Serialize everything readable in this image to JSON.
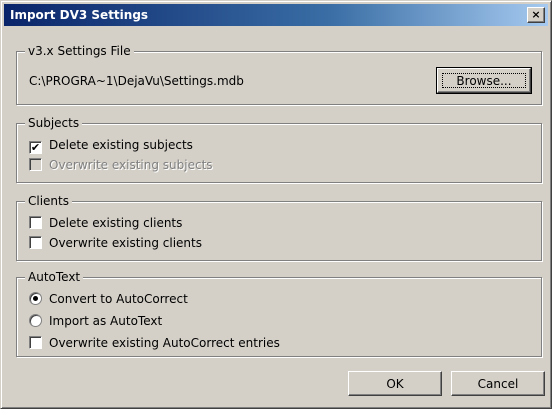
{
  "window": {
    "title": "Import DV3 Settings",
    "close_label": "×"
  },
  "settings_file": {
    "group_label": "v3.x Settings File",
    "path": "C:\\PROGRA~1\\DejaVu\\Settings.mdb",
    "browse_label": "Browse..."
  },
  "subjects": {
    "group_label": "Subjects",
    "options": [
      {
        "label": "Delete existing subjects",
        "checked": true,
        "enabled": true
      },
      {
        "label": "Overwrite existing subjects",
        "checked": false,
        "enabled": false
      }
    ]
  },
  "clients": {
    "group_label": "Clients",
    "options": [
      {
        "label": "Delete existing clients",
        "checked": false,
        "enabled": true
      },
      {
        "label": "Overwrite existing clients",
        "checked": false,
        "enabled": true
      }
    ]
  },
  "autotext": {
    "group_label": "AutoText",
    "radios": [
      {
        "label": "Convert to AutoCorrect",
        "selected": true
      },
      {
        "label": "Import as AutoText",
        "selected": false
      }
    ],
    "overwrite": {
      "label": "Overwrite existing AutoCorrect entries",
      "checked": false
    }
  },
  "buttons": {
    "ok_label": "OK",
    "cancel_label": "Cancel"
  }
}
